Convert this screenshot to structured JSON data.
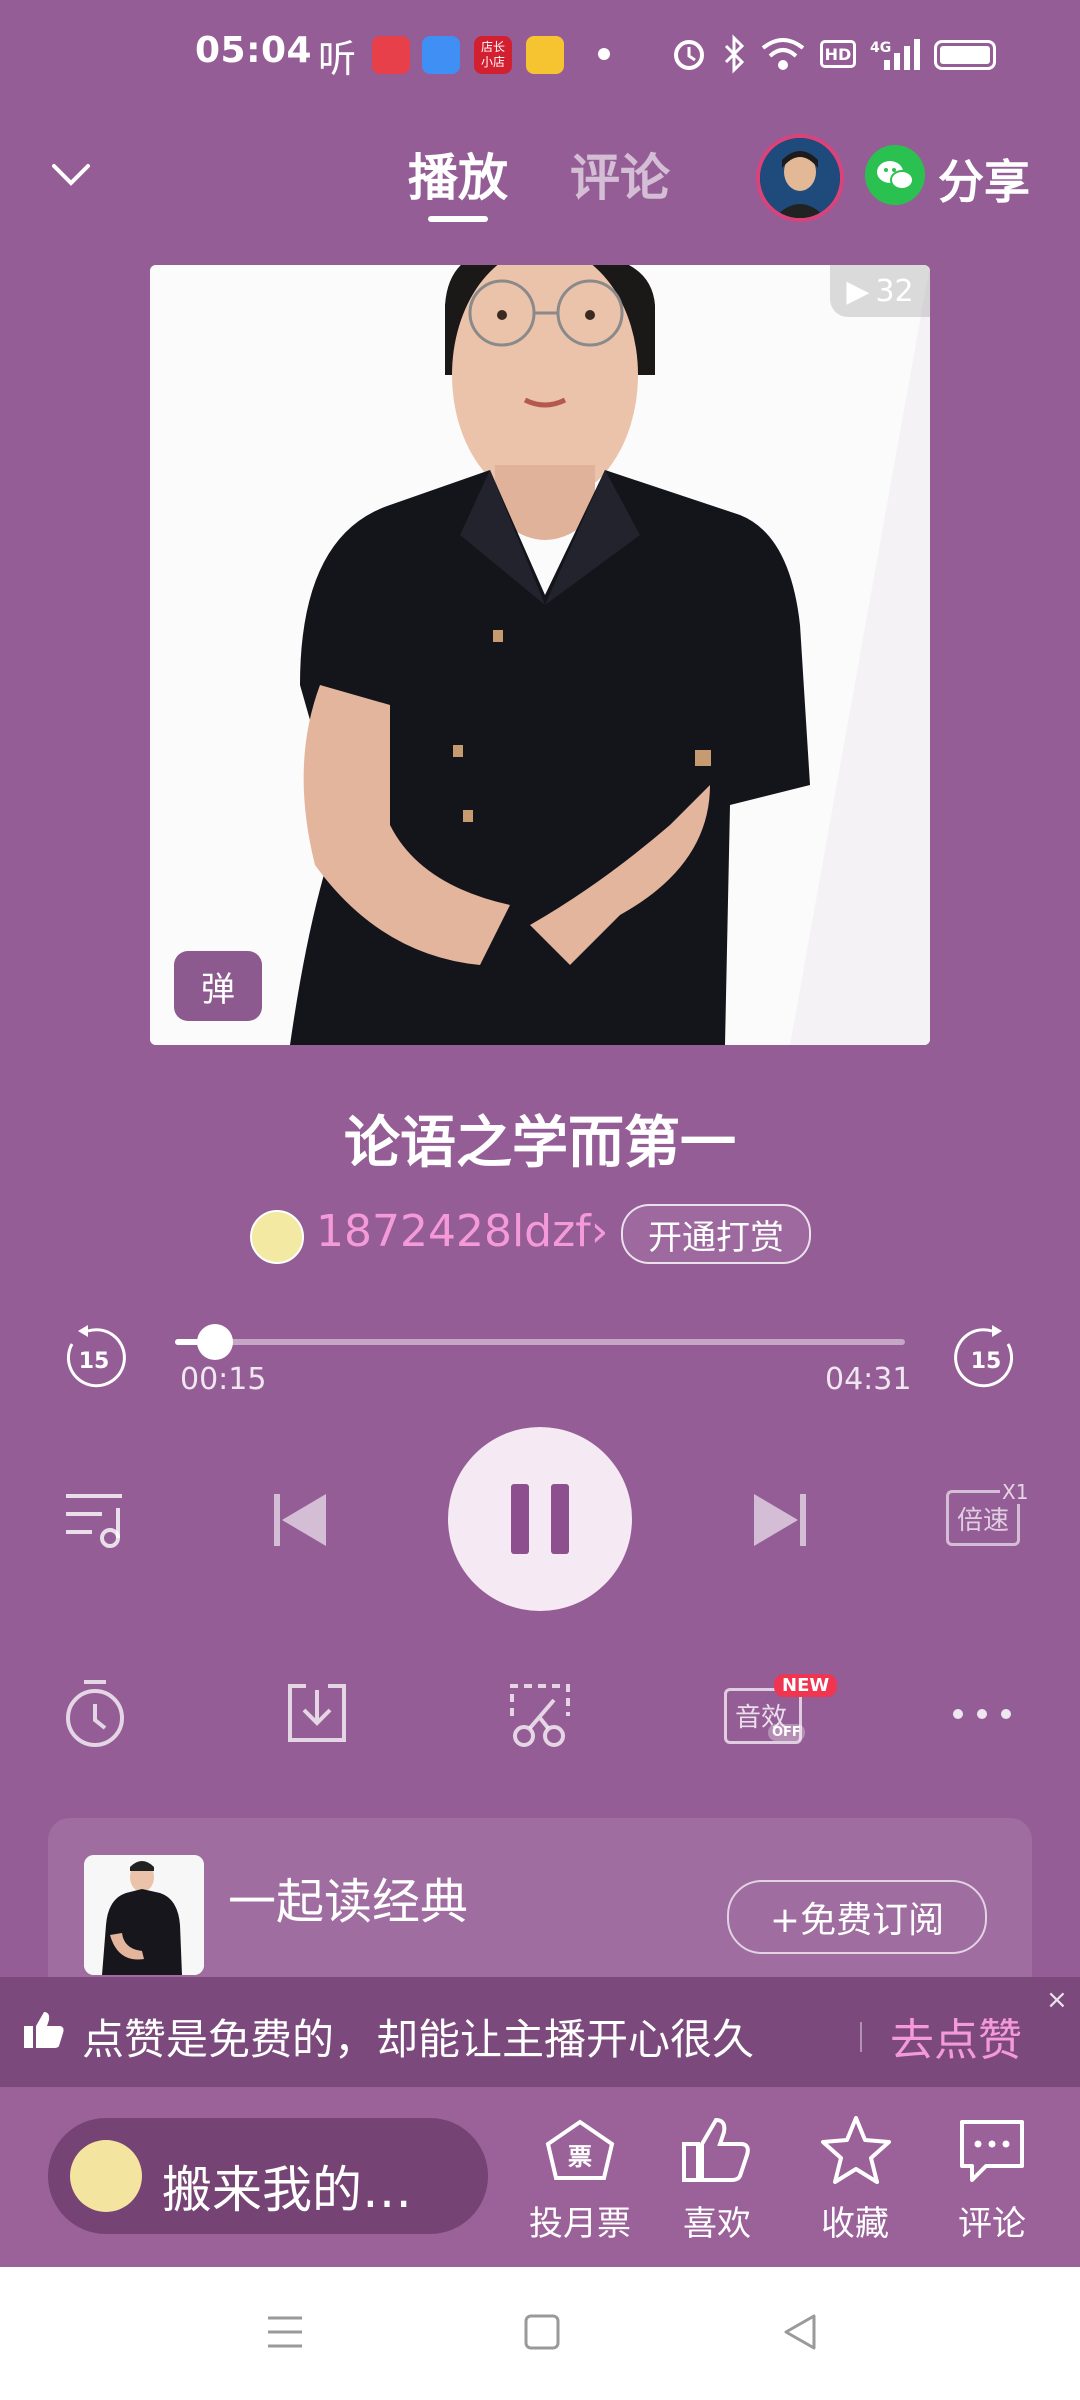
{
  "status_bar": {
    "time": "05:04",
    "ting_label": "听",
    "mini_app_badge": "店长\n小店"
  },
  "nav": {
    "tabs": [
      {
        "label": "播放",
        "active": true
      },
      {
        "label": "评论",
        "active": false
      }
    ],
    "share_label": "分享"
  },
  "cover": {
    "play_count": "32",
    "danmu_label": "弹"
  },
  "track": {
    "title": "论语之学而第一",
    "author": "1872428ldzf",
    "author_chevron": "›",
    "reward_label": "开通打赏"
  },
  "progress": {
    "current": "00:15",
    "duration": "04:31",
    "fraction": 0.055,
    "rewind_seconds": "15",
    "forward_seconds": "15"
  },
  "controls": {
    "speed_label": "倍速",
    "speed_value": "X1",
    "effect_label": "音效",
    "effect_state": "OFF",
    "effect_badge": "NEW"
  },
  "album": {
    "title": "一起读经典",
    "subscribe_label": "+免费订阅"
  },
  "toast": {
    "text": "点赞是免费的，却能让主播开心很久",
    "action": "去点赞",
    "close": "×"
  },
  "bottom_bar": {
    "comment_placeholder": "搬来我的…",
    "actions": [
      {
        "label": "投月票",
        "icon": "ticket-icon"
      },
      {
        "label": "喜欢",
        "icon": "thumb-up-icon"
      },
      {
        "label": "收藏",
        "icon": "star-icon"
      },
      {
        "label": "评论",
        "icon": "comment-icon"
      }
    ],
    "ticket_glyph": "票"
  },
  "colors": {
    "background": "#955d96",
    "accent_pink": "#f59ad8",
    "play_button": "#f5e9f3",
    "wechat_green": "#2bc151"
  }
}
